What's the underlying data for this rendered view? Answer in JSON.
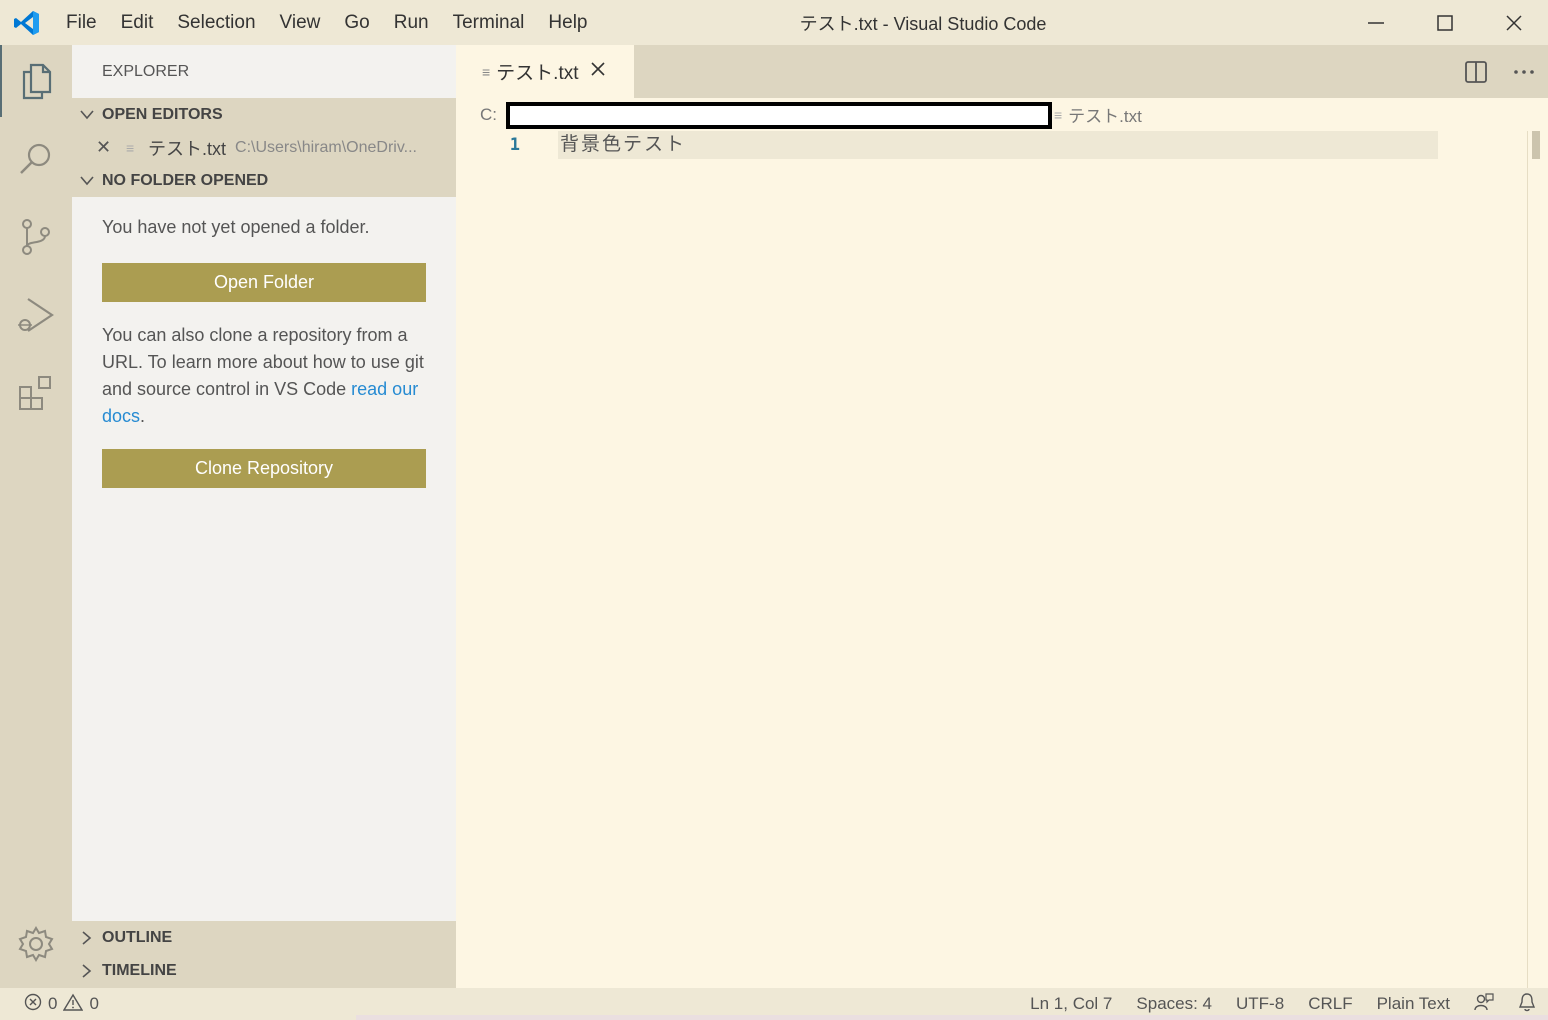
{
  "titlebar": {
    "menu": [
      "File",
      "Edit",
      "Selection",
      "View",
      "Go",
      "Run",
      "Terminal",
      "Help"
    ],
    "window_title": "テスト.txt - Visual Studio Code"
  },
  "activity_icons": [
    "files-icon",
    "search-icon",
    "source-control-icon",
    "run-debug-icon",
    "extensions-icon",
    "settings-gear-icon"
  ],
  "sidebar": {
    "title": "EXPLORER",
    "open_editors_label": "OPEN EDITORS",
    "open_editor": {
      "name": "テスト.txt",
      "path": "C:\\Users\\hiram\\OneDriv..."
    },
    "no_folder_label": "NO FOLDER OPENED",
    "empty_message": "You have not yet opened a folder.",
    "open_folder_button": "Open Folder",
    "clone_message": "You can also clone a repository from a URL. To learn more about how to use git and source control in VS Code ",
    "docs_link": "read our docs",
    "docs_link_suffix": ".",
    "clone_button": "Clone Repository",
    "outline_label": "OUTLINE",
    "timeline_label": "TIMELINE"
  },
  "editor": {
    "tab_label": "テスト.txt",
    "breadcrumb_drive": "C:",
    "breadcrumb_file": "テスト.txt",
    "line_number": "1",
    "line_text": "背景色テスト"
  },
  "statusbar": {
    "errors": "0",
    "warnings": "0",
    "position": "Ln 1, Col 7",
    "spaces": "Spaces: 4",
    "encoding": "UTF-8",
    "eol": "CRLF",
    "language": "Plain Text"
  },
  "colors": {
    "editor_bg": "#fdf6e3",
    "sidebar_bg": "#f3f2ef",
    "chrome_bg": "#eee8d5",
    "button_bg": "#ab9d51",
    "link": "#268bd2",
    "vscode_blue": "#0065a9"
  }
}
